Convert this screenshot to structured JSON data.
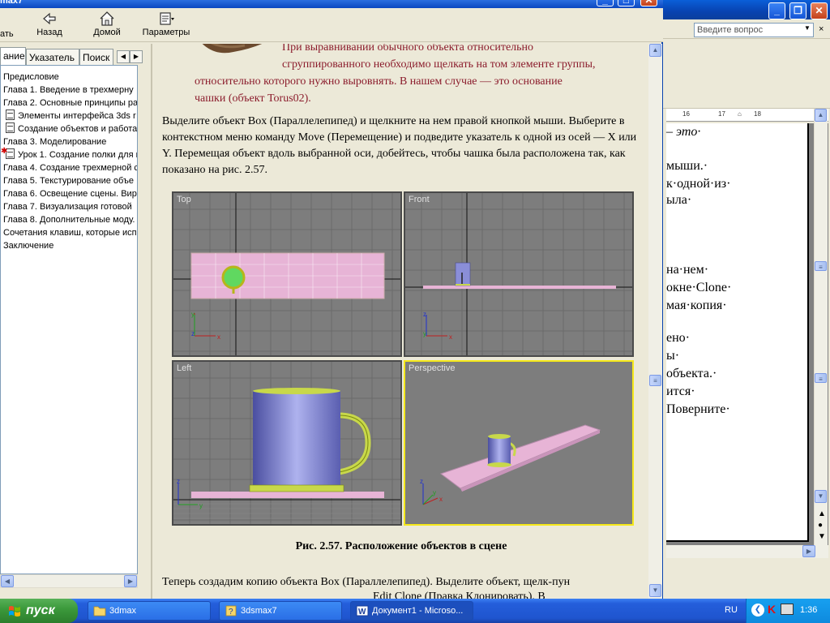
{
  "word": {
    "ask_placeholder": "Введите вопрос",
    "menu_close": "×",
    "ruler_labels": [
      "16",
      "17",
      "18"
    ],
    "page_lines": [
      "– это·",
      "мыши.·",
      "к·одной·из·",
      "ыла·",
      "на·нем·",
      "окне·Clone·",
      "мая·копия·",
      "ено·",
      "ы·",
      "объекта.·",
      "ится·",
      "Поверните·"
    ]
  },
  "help": {
    "title": "max7",
    "toolbar": {
      "hide_label": "ать",
      "back_label": "Назад",
      "home_label": "Домой",
      "options_label": "Параметры"
    },
    "tabs": {
      "contents": "ание",
      "index": "Указатель",
      "search": "Поиск"
    },
    "tree": [
      "Предисловие",
      "Глава 1. Введение в трехмерну",
      "Глава 2. Основные принципы ра",
      "Элементы интерфейса 3ds r",
      "Создание объектов и работа",
      "Глава 3. Моделирование",
      "Урок 1. Создание полки для г",
      "Глава 4. Создание трехмерной с",
      "Глава 5. Текстурирование объе",
      "Глава 6. Освещение сцены. Вир",
      "Глава 7. Визуализация готовой",
      "Глава 8. Дополнительные моду.",
      "Сочетания клавиш, которые исп",
      "Заключение"
    ],
    "content": {
      "note_lines": [
        "При выравнивании обычного объекта относительно",
        "сгруппированного необходимо щелкать на том элементе группы,",
        "относительно которого нужно выровнять. В нашем случае — это основание",
        "чашки (объект Torus02)."
      ],
      "paragraph1": "Выделите объект Box (Параллелепипед) и щелкните на нем правой кнопкой мыши. Выберите в контекстном меню команду Move (Перемещение) и подведите указатель к одной из осей — X или Y. Перемещая объект вдоль выбранной оси, добейтесь, чтобы чашка была расположена так, как показано на рис. 2.57.",
      "caption": "Рис. 2.57. Расположение объектов в сцене",
      "paragraph2": "Теперь создадим копию объекта Box (Параллелепипед). Выделите объект, щелк-пун",
      "paragraph2b": "Edit    Clone (Правка    Клонировать). В"
    },
    "viewports": {
      "top": "Top",
      "front": "Front",
      "left": "Left",
      "perspective": "Perspective"
    }
  },
  "taskbar": {
    "start_label": "пуск",
    "tasks": [
      "3dmax",
      "3dsmax7",
      "Документ1 - Microso..."
    ],
    "lang": "RU",
    "clock": "1:36"
  },
  "colors": {
    "titlebar_blue": "#0a47c0",
    "note_text": "#8b1c2c",
    "viewport_bg": "#7d7d7d",
    "active_viewport_border": "#f5e81a",
    "box_pink": "#e7b4d6",
    "cup_blue": "#8a8ed8",
    "handle_yellow_green": "#c8d84a"
  }
}
